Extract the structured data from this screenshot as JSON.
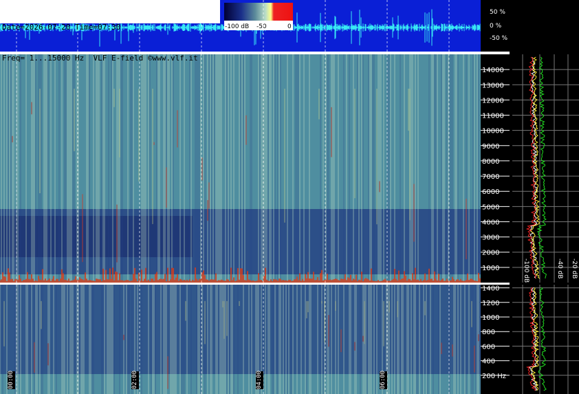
{
  "header": {
    "line1": "Date=2026-07-20 Time=07:30",
    "line2": "Freq= 1...15000 Hz  VLF E-field ©www.vlf.it"
  },
  "colorbar": {
    "labels": [
      "-100 dB",
      "-50",
      "0"
    ]
  },
  "waveform_axis": [
    "50 %",
    "0 %",
    "-50 %"
  ],
  "colors": {
    "waveform_bg": "#0a1fd6",
    "waveform_line": "#38e8f4",
    "spectrum_white": "#ffffff",
    "spectrum_yellow": "#ffee33",
    "spectrum_green": "#22dd22",
    "spectrum_red": "#ee2222"
  },
  "chart_data": [
    {
      "type": "heatmap",
      "title": "",
      "x": [
        "00:00",
        "02:00",
        "04:00",
        "06:00"
      ],
      "y_ticks": [
        1000,
        2000,
        3000,
        4000,
        5000,
        6000,
        7000,
        8000,
        9000,
        10000,
        11000,
        12000,
        13000,
        14000
      ],
      "ylim": [
        0,
        15000
      ],
      "ylabel": ""
    },
    {
      "type": "heatmap",
      "x": [
        "00:00",
        "02:00",
        "04:00",
        "06:00"
      ],
      "y_ticks": [
        "200 Hz",
        "400",
        "600",
        "800",
        "1000",
        "1200",
        "1400"
      ],
      "ylim": [
        0,
        1500
      ]
    },
    {
      "type": "line",
      "xlabels": [
        "-100 dB",
        "-40 dB",
        "-20 dB"
      ],
      "series": [
        {
          "color": "white"
        },
        {
          "color": "yellow"
        },
        {
          "color": "green"
        },
        {
          "color": "red"
        }
      ]
    }
  ]
}
